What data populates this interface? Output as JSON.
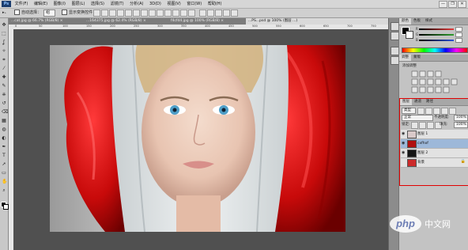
{
  "app": {
    "logo": "Ps"
  },
  "menubar": {
    "items": [
      "文件(F)",
      "编辑(E)",
      "图像(I)",
      "图层(L)",
      "选择(S)",
      "滤镜(T)",
      "分析(A)",
      "3D(D)",
      "视图(V)",
      "窗口(W)",
      "帮助(H)"
    ]
  },
  "window_controls": [
    "—",
    "❐",
    "✕"
  ],
  "options": {
    "auto_select_label": "自动选择：",
    "auto_select_value": "组",
    "transform_label": "显示变换控件"
  },
  "tabs": [
    "...cat.jpg @ 66.7% (RGB/8) ×",
    "...164375.jpg @ 62.4% (RGB/8) ×",
    "f4cfd4.jpg @ 100% (RGB/8) ×",
    "...PS...psd @ 100% (图层 ...)"
  ],
  "rulers": {
    "top": [
      "0",
      "50",
      "100",
      "150",
      "200",
      "250",
      "300",
      "350",
      "400",
      "450",
      "500",
      "550",
      "600",
      "650",
      "700",
      "750"
    ]
  },
  "color_panel": {
    "tabs": [
      "颜色",
      "色板",
      "样式"
    ],
    "channels": [
      "R",
      "G",
      "B"
    ],
    "colors": {
      "fg": "#000000",
      "bg": "#ffffff",
      "r": "#e23a3a",
      "g": "#2f9e2f",
      "b": "#2a4fd6"
    }
  },
  "adjustments_panel": {
    "tabs": [
      "调整",
      "蒙版"
    ],
    "title": "添加调整"
  },
  "layers_panel": {
    "tabs": [
      "图层",
      "通道",
      "路径"
    ],
    "kind_label": "类型",
    "blend_mode": "正常",
    "opacity_label": "不透明度:",
    "opacity_value": "100%",
    "lock_label": "锁定:",
    "fill_label": "填充:",
    "fill_value": "100%",
    "layers": [
      {
        "name": "图层 1",
        "thumb": "#d9c9c9",
        "visible": true,
        "selected": false
      },
      {
        "name": "cxfhxf",
        "thumb": "#b01010",
        "visible": true,
        "selected": true
      },
      {
        "name": "图层 2",
        "thumb": "#151515",
        "visible": true,
        "selected": false
      },
      {
        "name": "背景",
        "thumb": "#cc2a2a",
        "visible": false,
        "selected": false,
        "locked": true
      }
    ]
  },
  "watermark": {
    "text": "php",
    "site": "中文网"
  },
  "icons": [
    "move-tool-icon",
    "marquee-tool-icon",
    "lasso-tool-icon",
    "magic-wand-icon",
    "crop-tool-icon",
    "eyedropper-icon",
    "healing-brush-icon",
    "brush-tool-icon",
    "clone-stamp-icon",
    "history-brush-icon",
    "eraser-icon",
    "gradient-icon",
    "blur-icon",
    "dodge-icon",
    "pen-tool-icon",
    "type-tool-icon",
    "path-select-icon",
    "shape-tool-icon",
    "hand-tool-icon",
    "zoom-tool-icon",
    "eye-icon",
    "lock-icon"
  ]
}
